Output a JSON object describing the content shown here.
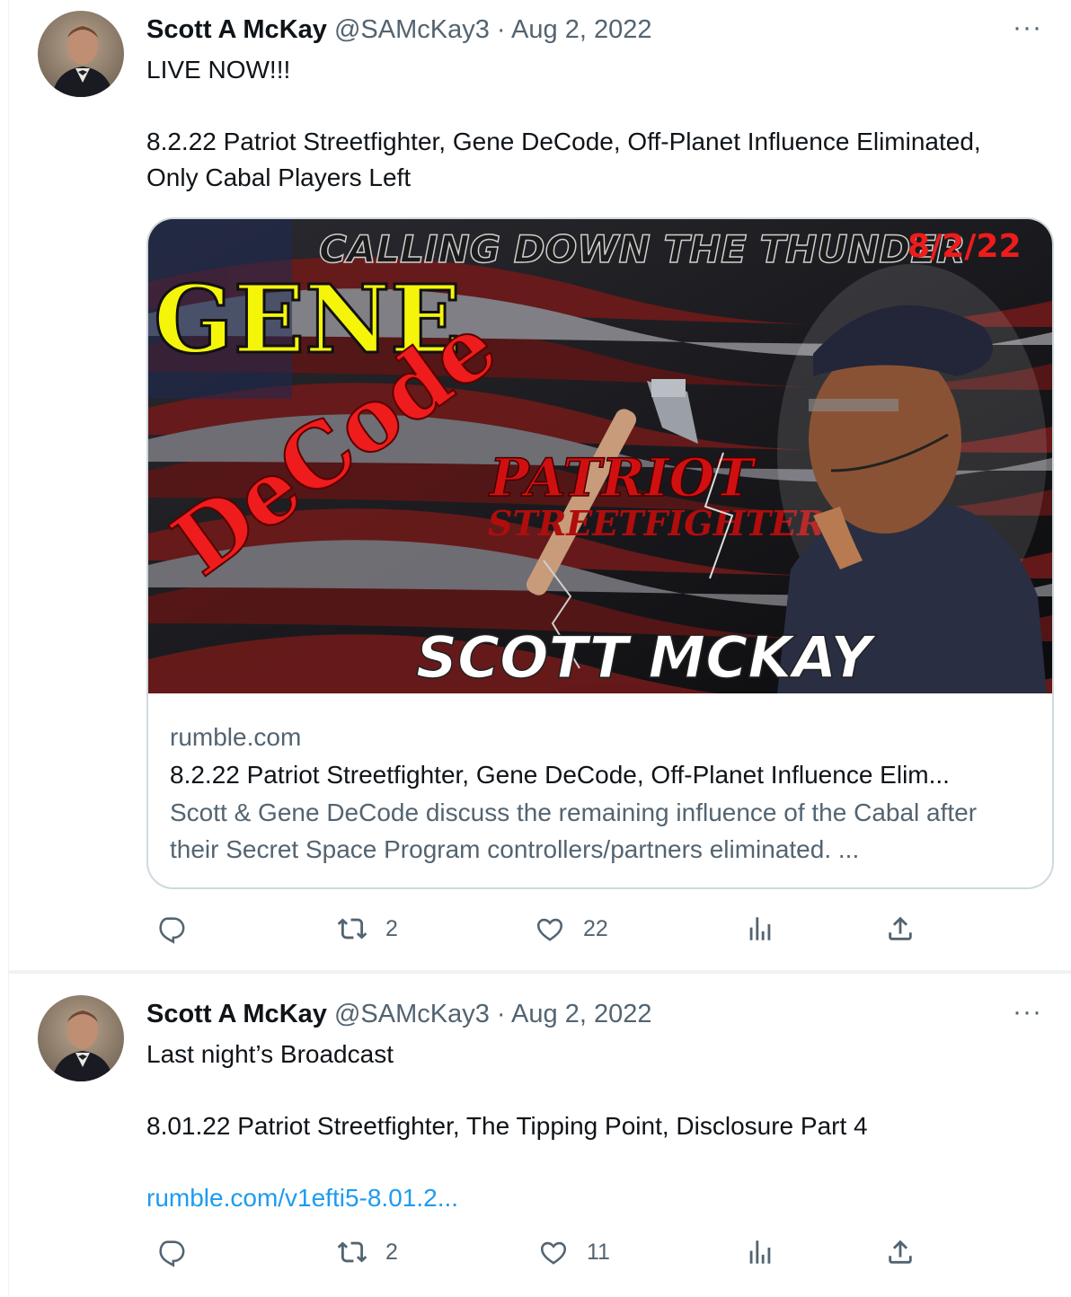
{
  "tweets": [
    {
      "author_name": "Scott A McKay",
      "handle": "@SAMcKay3",
      "date": "Aug 2, 2022",
      "separator": "·",
      "more_label": "···",
      "lines": [
        "LIVE NOW!!!",
        "",
        "8.2.22 Patriot Streetfighter, Gene DeCode, Off-Planet Influence Eliminated, Only Cabal Players Left"
      ],
      "card": {
        "image_text": {
          "banner": "CALLING DOWN THE THUNDER",
          "date": "8/2/22",
          "gene": "GENE",
          "decode": "DeCode",
          "patriot": "PATRIOT",
          "streetfighter": "STREETFIGHTER",
          "host": "SCOTT MCKAY"
        },
        "domain": "rumble.com",
        "title": "8.2.22 Patriot Streetfighter, Gene DeCode, Off-Planet Influence Elim...",
        "description": "Scott & Gene DeCode discuss the remaining influence of the Cabal after their Secret Space Program controllers/partners eliminated. ..."
      },
      "actions": {
        "replies": "",
        "retweets": "2",
        "likes": "22",
        "views": ""
      }
    },
    {
      "author_name": "Scott A McKay",
      "handle": "@SAMcKay3",
      "date": "Aug 2, 2022",
      "separator": "·",
      "more_label": "···",
      "lines": [
        "Last night’s Broadcast",
        "",
        "8.01.22 Patriot Streetfighter, The Tipping Point, Disclosure Part 4",
        ""
      ],
      "link": "rumble.com/v1efti5-8.01.2...",
      "actions": {
        "replies": "",
        "retweets": "2",
        "likes": "11",
        "views": ""
      }
    }
  ],
  "colors": {
    "text": "#0f1419",
    "secondary": "#536471",
    "link": "#1d9bf0",
    "border": "#cfd9de",
    "divider": "#eff3f4",
    "image_yellow": "#f5f50a",
    "image_red": "#ee1c1c"
  },
  "icons": [
    "reply-icon",
    "retweet-icon",
    "like-icon",
    "views-icon",
    "share-icon",
    "more-icon"
  ]
}
